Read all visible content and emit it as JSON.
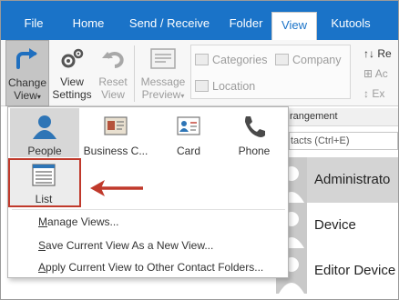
{
  "tabs": [
    "File",
    "Home",
    "Send / Receive",
    "Folder",
    "View",
    "Kutools"
  ],
  "active_tab": "View",
  "ribbon": {
    "change_view": [
      "Change",
      "View"
    ],
    "view_settings": [
      "View",
      "Settings"
    ],
    "reset_view": [
      "Reset",
      "View"
    ],
    "message_preview": [
      "Message",
      "Preview"
    ],
    "fields": {
      "categories": "Categories",
      "company": "Company",
      "location": "Location"
    },
    "truncated": {
      "re": "Re",
      "ac": "Ac",
      "ex": "Ex"
    }
  },
  "contacts_pane": {
    "header": "rangement",
    "search": "tacts (Ctrl+E)",
    "contacts": [
      "Administrato",
      "Device",
      "Editor Device"
    ]
  },
  "dropdown": {
    "views": [
      "People",
      "Business C...",
      "Card",
      "Phone"
    ],
    "list_label": "List",
    "menu_items": [
      {
        "label": "Manage Views...",
        "access_key": "M"
      },
      {
        "label": "Save Current View As a New View...",
        "access_key": "S"
      },
      {
        "label": "Apply Current View to Other Contact Folders...",
        "access_key": "A"
      }
    ]
  },
  "colors": {
    "accent": "#1a73c8",
    "highlight_border": "#c0392b",
    "arrow": "#c0392b"
  },
  "icons": [
    "change-view-icon",
    "view-settings-icon",
    "reset-view-icon",
    "message-preview-icon",
    "people-icon",
    "business-card-icon",
    "card-icon",
    "phone-icon",
    "list-icon",
    "arrow-icon"
  ]
}
